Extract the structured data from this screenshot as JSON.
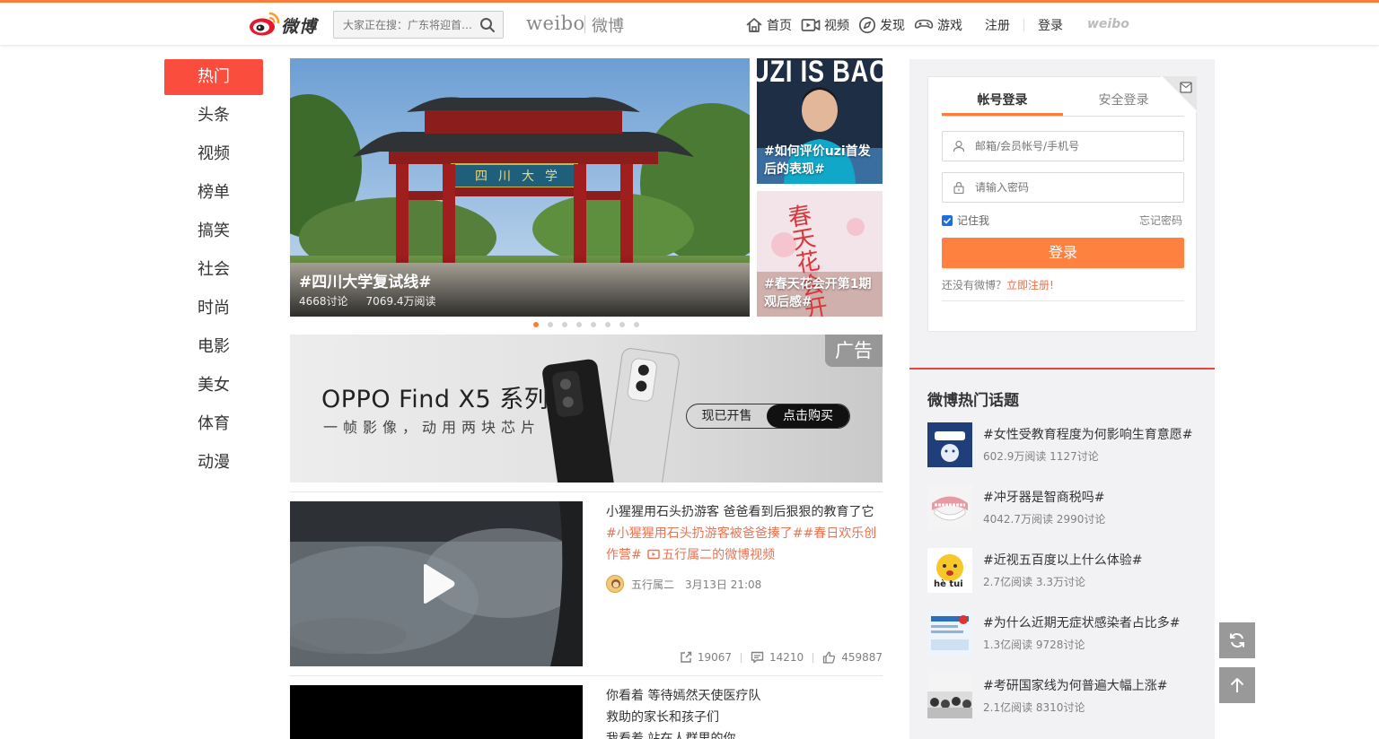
{
  "header": {
    "logo_text": "微博",
    "search_placeholder": "大家正在搜：广东将迎首…",
    "brand_weibo": "weibo",
    "brand_cn": "微博",
    "nav": [
      {
        "label": "首页",
        "icon": "home-icon"
      },
      {
        "label": "视频",
        "icon": "video-icon"
      },
      {
        "label": "发现",
        "icon": "compass-icon"
      },
      {
        "label": "游戏",
        "icon": "gamepad-icon"
      }
    ],
    "register": "注册",
    "login": "登录",
    "mini_logo": "weibo"
  },
  "categories": [
    "热门",
    "头条",
    "视频",
    "榜单",
    "搞笑",
    "社会",
    "时尚",
    "电影",
    "美女",
    "体育",
    "动漫"
  ],
  "active_category": "热门",
  "hero": {
    "title": "#四川大学复试线#",
    "discussions": "4668讨论",
    "reads": "7069.4万阅读",
    "sign_text": "四川大学",
    "slides_count": 8,
    "active_slide": 1
  },
  "side_cards": [
    {
      "caption": "#如何评价uzi首发后的表现#",
      "bg_text": "UZI IS BACK"
    },
    {
      "caption": "#春天花会开第1期观后感#",
      "bg_text": "春天花会开"
    }
  ],
  "ad": {
    "tag": "广告",
    "title": "OPPO Find X5 系列",
    "subtitle": "一帧影像，动用两块芯片",
    "cta_left": "现已开售",
    "cta_right": "点击购买"
  },
  "feed": [
    {
      "text_plain": "小猩猩用石头扔游客 爸爸看到后狠狠的教育了它",
      "text_link": "#小猩猩用石头扔游客被爸爸揍了##春日欢乐创作营# ",
      "text_video": "五行属二的微博视频",
      "author": "五行属二",
      "time": "3月13日 21:08",
      "reposts": "19067",
      "comments": "14210",
      "likes": "459887"
    },
    {
      "lines": [
        "你看着 等待嫣然天使医疗队",
        "救助的家长和孩子们",
        "我看着 站在人群里的你"
      ]
    }
  ],
  "login": {
    "tab_account": "帐号登录",
    "tab_secure": "安全登录",
    "username_placeholder": "邮箱/会员帐号/手机号",
    "password_placeholder": "请输入密码",
    "remember": "记住我",
    "forget": "忘记密码",
    "submit": "登录",
    "no_account": "还没有微博？",
    "register_now": "立即注册!"
  },
  "hot_topics": {
    "title": "微博热门话题",
    "items": [
      {
        "name": "#女性受教育程度为何影响生育意愿#",
        "stats": "602.9万阅读 1127讨论"
      },
      {
        "name": "#冲牙器是智商税吗#",
        "stats": "4042.7万阅读 2990讨论"
      },
      {
        "name": "#近视五百度以上什么体验#",
        "stats": "2.7亿阅读 3.3万讨论",
        "thumb_text": "hè tui"
      },
      {
        "name": "#为什么近期无症状感染者占比多#",
        "stats": "1.3亿阅读 9728讨论"
      },
      {
        "name": "#考研国家线为何普遍大幅上涨#",
        "stats": "2.1亿阅读 8310讨论"
      }
    ]
  },
  "colors": {
    "accent": "#fa7d3c",
    "active_category": "#fb4d3d",
    "link": "#eb7350",
    "hot_line": "#e64545"
  }
}
